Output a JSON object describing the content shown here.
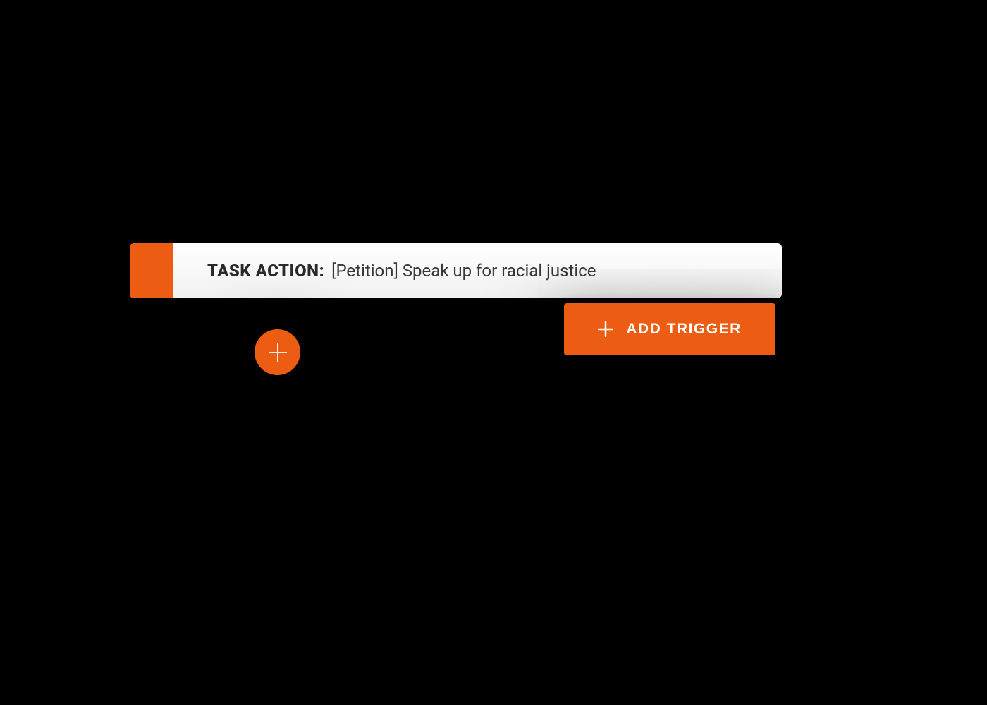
{
  "colors": {
    "accent": "#ed5c13",
    "background": "#000000",
    "card": "#ffffff"
  },
  "task": {
    "label": "TASK ACTION:",
    "value": "[Petition] Speak up for racial justice"
  },
  "buttons": {
    "add_trigger": "ADD TRIGGER"
  }
}
